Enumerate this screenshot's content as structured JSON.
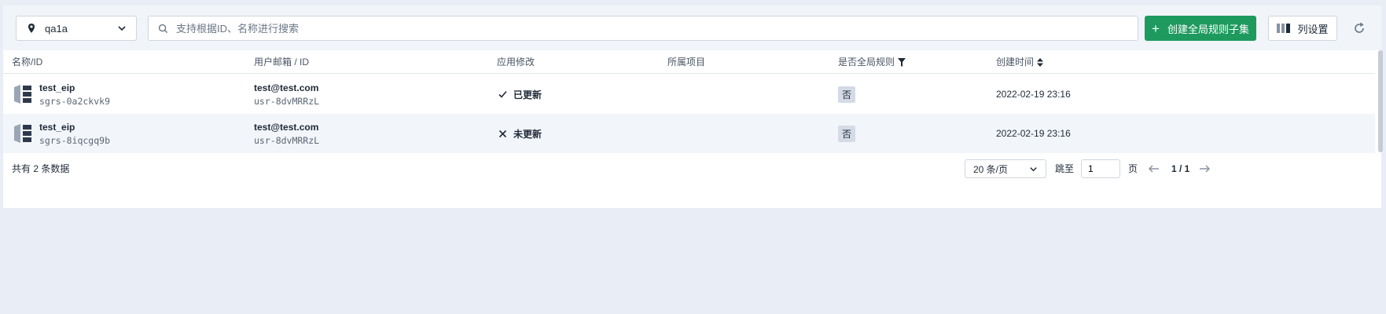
{
  "toolbar": {
    "zone": "qa1a",
    "search_placeholder": "支持根据ID、名称进行搜索",
    "create_label": "创建全局规则子集",
    "columns_label": "列设置"
  },
  "table": {
    "headers": {
      "name": "名称/ID",
      "owner": "用户邮箱 / ID",
      "apply": "应用修改",
      "project": "所属项目",
      "global": "是否全局规则",
      "created": "创建时间"
    },
    "rows": [
      {
        "name": "test_eip",
        "id": "sgrs-0a2ckvk9",
        "email": "test@test.com",
        "user_id": "usr-8dvMRRzL",
        "status_icon": "check-icon",
        "status": "已更新",
        "project": "",
        "global": "否",
        "created": "2022-02-19 23:16"
      },
      {
        "name": "test_eip",
        "id": "sgrs-8iqcgq9b",
        "email": "test@test.com",
        "user_id": "usr-8dvMRRzL",
        "status_icon": "cross-icon",
        "status": "未更新",
        "project": "",
        "global": "否",
        "created": "2022-02-19 23:16"
      }
    ]
  },
  "footer": {
    "total": "共有 2 条数据",
    "page_size": "20 条/页",
    "jump_label": "跳至",
    "jump_value": "1",
    "page_label": "页",
    "page_info": "1 / 1"
  },
  "colors": {
    "primary": "#1e9a5e",
    "background": "#e9edf5",
    "row_alt": "#f2f5fa",
    "badge": "#d4dbe6"
  }
}
